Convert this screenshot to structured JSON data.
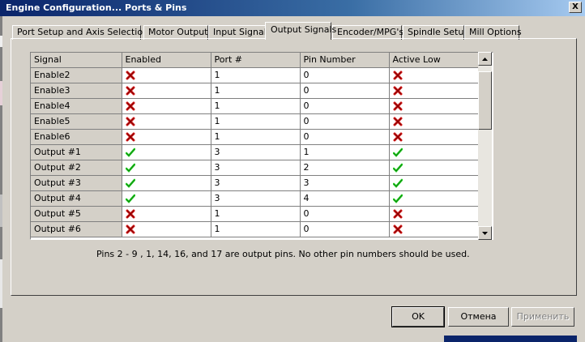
{
  "window": {
    "title": "Engine Configuration... Ports & Pins",
    "close_label": "X"
  },
  "tabs": [
    {
      "label": "Port Setup and Axis Selection",
      "active": false
    },
    {
      "label": "Motor Outputs",
      "active": false
    },
    {
      "label": "Input Signals",
      "active": false
    },
    {
      "label": "Output Signals",
      "active": true
    },
    {
      "label": "Encoder/MPG's",
      "active": false
    },
    {
      "label": "Spindle Setup",
      "active": false
    },
    {
      "label": "Mill Options",
      "active": false
    }
  ],
  "grid": {
    "columns": [
      "Signal",
      "Enabled",
      "Port #",
      "Pin Number",
      "Active Low"
    ],
    "rows": [
      {
        "signal": "Enable2",
        "enabled": "cross-icon",
        "port": "1",
        "pin": "0",
        "active_low": "cross-icon"
      },
      {
        "signal": "Enable3",
        "enabled": "cross-icon",
        "port": "1",
        "pin": "0",
        "active_low": "cross-icon"
      },
      {
        "signal": "Enable4",
        "enabled": "cross-icon",
        "port": "1",
        "pin": "0",
        "active_low": "cross-icon"
      },
      {
        "signal": "Enable5",
        "enabled": "cross-icon",
        "port": "1",
        "pin": "0",
        "active_low": "cross-icon"
      },
      {
        "signal": "Enable6",
        "enabled": "cross-icon",
        "port": "1",
        "pin": "0",
        "active_low": "cross-icon"
      },
      {
        "signal": "Output #1",
        "enabled": "check-icon",
        "port": "3",
        "pin": "1",
        "active_low": "check-icon"
      },
      {
        "signal": "Output #2",
        "enabled": "check-icon",
        "port": "3",
        "pin": "2",
        "active_low": "check-icon"
      },
      {
        "signal": "Output #3",
        "enabled": "check-icon",
        "port": "3",
        "pin": "3",
        "active_low": "check-icon"
      },
      {
        "signal": "Output #4",
        "enabled": "check-icon",
        "port": "3",
        "pin": "4",
        "active_low": "check-icon"
      },
      {
        "signal": "Output #5",
        "enabled": "cross-icon",
        "port": "1",
        "pin": "0",
        "active_low": "cross-icon"
      },
      {
        "signal": "Output #6",
        "enabled": "cross-icon",
        "port": "1",
        "pin": "0",
        "active_low": "cross-icon"
      }
    ]
  },
  "note": "Pins 2 - 9 , 1, 14, 16, and 17 are output pins. No  other pin numbers should be used.",
  "buttons": {
    "ok": "OK",
    "cancel": "Отмена",
    "apply": "Применить"
  },
  "colors": {
    "check": "#22cc22",
    "cross": "#cc1111",
    "titlebar": "#0a246a",
    "face": "#d4d0c8"
  }
}
